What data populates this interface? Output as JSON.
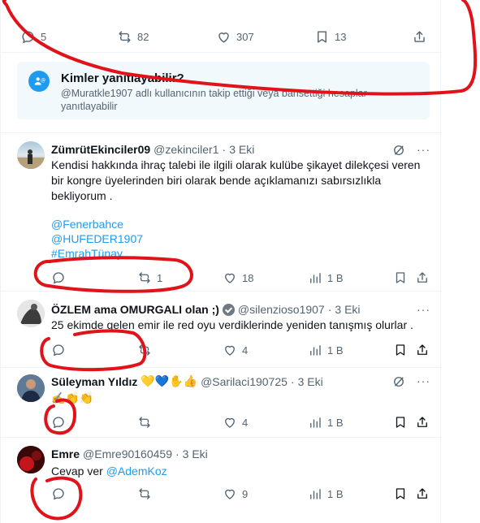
{
  "main_post_actions": {
    "replies": "5",
    "reposts": "82",
    "likes": "307",
    "bookmarks": "13"
  },
  "reply_notice": {
    "title": "Kimler yanıtlayabilir?",
    "text": "@Murat\u0000 adlı kullanıcının takip ettiği veya bahsettiği hesaplar yanıtlayabilir"
  },
  "replies": [
    {
      "name": "ZümrütEkinciler09",
      "handle": "@zekinciler1",
      "time": "3 Eki",
      "text": "Kendisi hakkında ihraç talebi  ile ilgili olarak kulübe şikayet dilekçesi veren bir kongre üyelerinden biri olarak bende açıklamanızı sabırsızlıkla bekliyorum .",
      "mentions": [
        "@Fenerbahce",
        "@HUFEDER1907",
        "#EmrahTünay"
      ],
      "replies": "",
      "reposts": "1",
      "likes": "18",
      "views": "1 B"
    },
    {
      "name": "ÖZLEM ama OMURGALI olan ;)",
      "handle": "@silenzioso1907",
      "time": "3 Eki",
      "text": "25 ekimde gelen emir ile red oyu verdiklerinde yeniden tanışmış olurlar .",
      "replies": "",
      "reposts": "",
      "likes": "4",
      "views": "1 B"
    },
    {
      "name": "Süleyman Yıldız",
      "name_emoji": "💛💙✋👍",
      "handle": "@Sarilaci190725",
      "time": "3 Eki",
      "text": "✍️👏👏",
      "replies": "",
      "reposts": "",
      "likes": "4",
      "views": "1 B"
    },
    {
      "name": "Emre",
      "handle": "@Emre90160459",
      "time": "3 Eki",
      "text_prefix": "Cevap ver",
      "mention": "@AdemKoz",
      "replies": "",
      "reposts": "",
      "likes": "9",
      "views": "1 B"
    }
  ],
  "more_label": "···",
  "colors": {
    "accent": "#1d9bf0",
    "annotation": "#e0131a",
    "muted": "#536471"
  }
}
